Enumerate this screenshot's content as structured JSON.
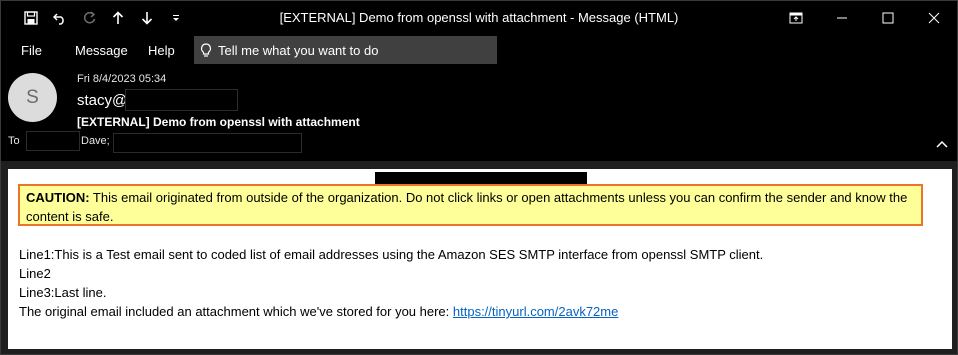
{
  "titlebar": {
    "title": "[EXTERNAL] Demo from openssl with attachment  -  Message (HTML)",
    "quick_access": [
      "save-icon",
      "undo-icon",
      "redo-icon",
      "up-arrow-icon",
      "down-arrow-icon",
      "customize-icon"
    ],
    "window_controls": [
      "restore-ribbon-icon",
      "minimize-icon",
      "maximize-icon",
      "close-icon"
    ]
  },
  "menu": {
    "items": [
      "File",
      "Message",
      "Help"
    ],
    "tell_me": "Tell me what you want to do"
  },
  "header": {
    "avatar_initial": "S",
    "date": "Fri 8/4/2023 05:34",
    "sender": "stacy@",
    "subject": "[EXTERNAL] Demo from openssl with attachment",
    "to_label": "To",
    "recipient": "Dave;"
  },
  "body": {
    "caution_label": "CAUTION:",
    "caution_text": " This email originated from outside of the organization. Do not click links or open attachments unless you can confirm the sender and know the content is safe.",
    "line1": "Line1:This is a Test email sent to coded list of email addresses using the Amazon SES SMTP interface from openssl SMTP client.",
    "line2": "Line2",
    "line3": "Line3:Last line.",
    "line4_prefix": "The original email included an attachment which we've stored for you here: ",
    "link": "https://tinyurl.com/2avk72me"
  },
  "colors": {
    "caution_bg": "#ffff99",
    "caution_border": "#e8752a",
    "link": "#0563c1"
  }
}
